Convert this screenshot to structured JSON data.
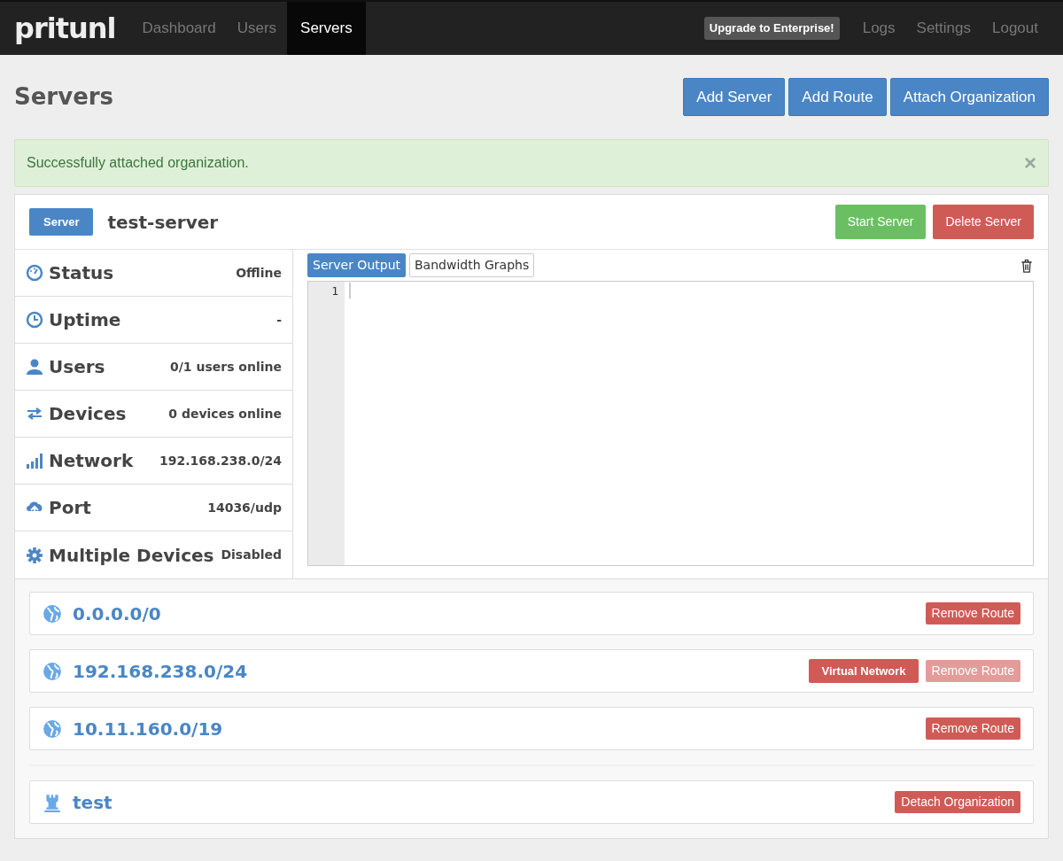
{
  "navbar": {
    "brand": "pritunl",
    "nav_items": [
      {
        "label": "Dashboard",
        "selected": false
      },
      {
        "label": "Users",
        "selected": false
      },
      {
        "label": "Servers",
        "selected": true
      }
    ],
    "upgrade_button": "Upgrade to Enterprise!",
    "right_links": [
      "Logs",
      "Settings",
      "Logout"
    ]
  },
  "page": {
    "title": "Servers",
    "buttons": [
      "Add Server",
      "Add Route",
      "Attach Organization"
    ]
  },
  "alert": {
    "text": "Successfully attached organization.",
    "close": "×"
  },
  "server": {
    "label": "Server",
    "name": "test-server",
    "buttons": [
      {
        "label": "Start Server",
        "kind": "success"
      },
      {
        "label": "Delete Server",
        "kind": "danger"
      }
    ],
    "stats": [
      {
        "kind": "status",
        "label": "Status",
        "value": "Offline"
      },
      {
        "kind": "uptime",
        "label": "Uptime",
        "value": "-"
      },
      {
        "kind": "users",
        "label": "Users",
        "value": "0/1 users online"
      },
      {
        "kind": "devices",
        "label": "Devices",
        "value": "0 devices online"
      },
      {
        "kind": "network",
        "label": "Network",
        "value": "192.168.238.0/24"
      },
      {
        "kind": "port",
        "label": "Port",
        "value": "14036/udp"
      },
      {
        "kind": "multi",
        "label": "Multiple Devices",
        "value": "Disabled"
      }
    ],
    "output_tabs": [
      {
        "label": "Server Output",
        "selected": true
      },
      {
        "label": "Bandwidth Graphs",
        "selected": false
      }
    ],
    "editor": {
      "line_numbers": [
        "1"
      ]
    },
    "routes": [
      {
        "network": "0.0.0.0/0",
        "remove": "Remove Route",
        "disabled": false
      },
      {
        "network": "192.168.238.0/24",
        "badge": "Virtual Network",
        "remove": "Remove Route",
        "disabled": true
      },
      {
        "network": "10.11.160.0/19",
        "remove": "Remove Route",
        "disabled": false
      }
    ],
    "organizations": [
      {
        "name": "test",
        "detach": "Detach Organization"
      }
    ]
  }
}
